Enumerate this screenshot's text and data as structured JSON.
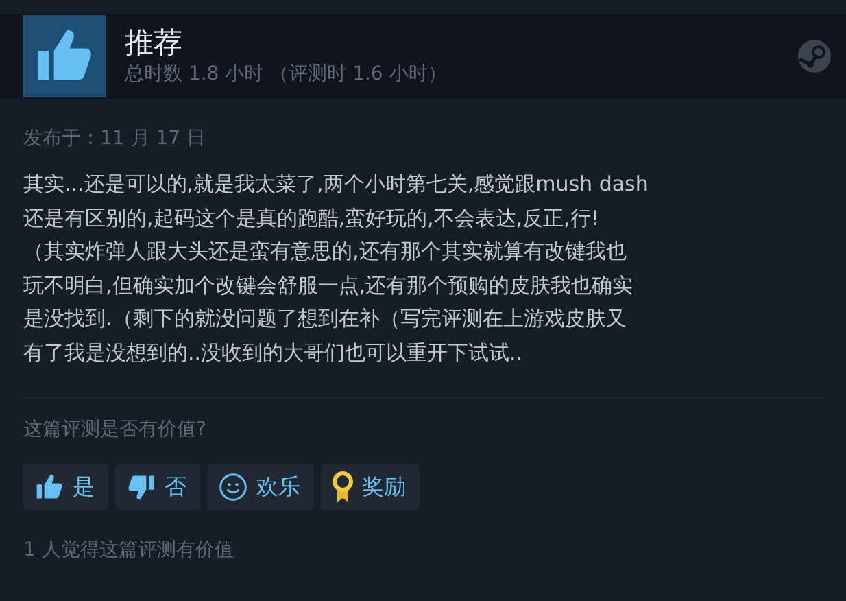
{
  "header": {
    "title": "推荐",
    "playtime": "总时数 1.8 小时 （评测时 1.6 小时）"
  },
  "posted": "发布于：11 月 17 日",
  "body_lines": [
    "其实...还是可以的,就是我太菜了,两个小时第七关,感觉跟mush dash",
    "还是有区别的,起码这个是真的跑酷,蛮好玩的,不会表达,反正,行!",
    "（其实炸弹人跟大头还是蛮有意思的,还有那个其实就算有改键我也",
    "玩不明白,但确实加个改键会舒服一点,还有那个预购的皮肤我也确实",
    "是没找到.（剩下的就没问题了想到在补（写完评测在上游戏皮肤又",
    "有了我是没想到的..没收到的大哥们也可以重开下试试.."
  ],
  "question": "这篇评测是否有价值?",
  "buttons": [
    {
      "kind": "yes",
      "label": "是"
    },
    {
      "kind": "no",
      "label": "否"
    },
    {
      "kind": "funny",
      "label": "欢乐"
    },
    {
      "kind": "award",
      "label": "奖励"
    }
  ],
  "helpful_count": "1 人觉得这篇评测有价值"
}
